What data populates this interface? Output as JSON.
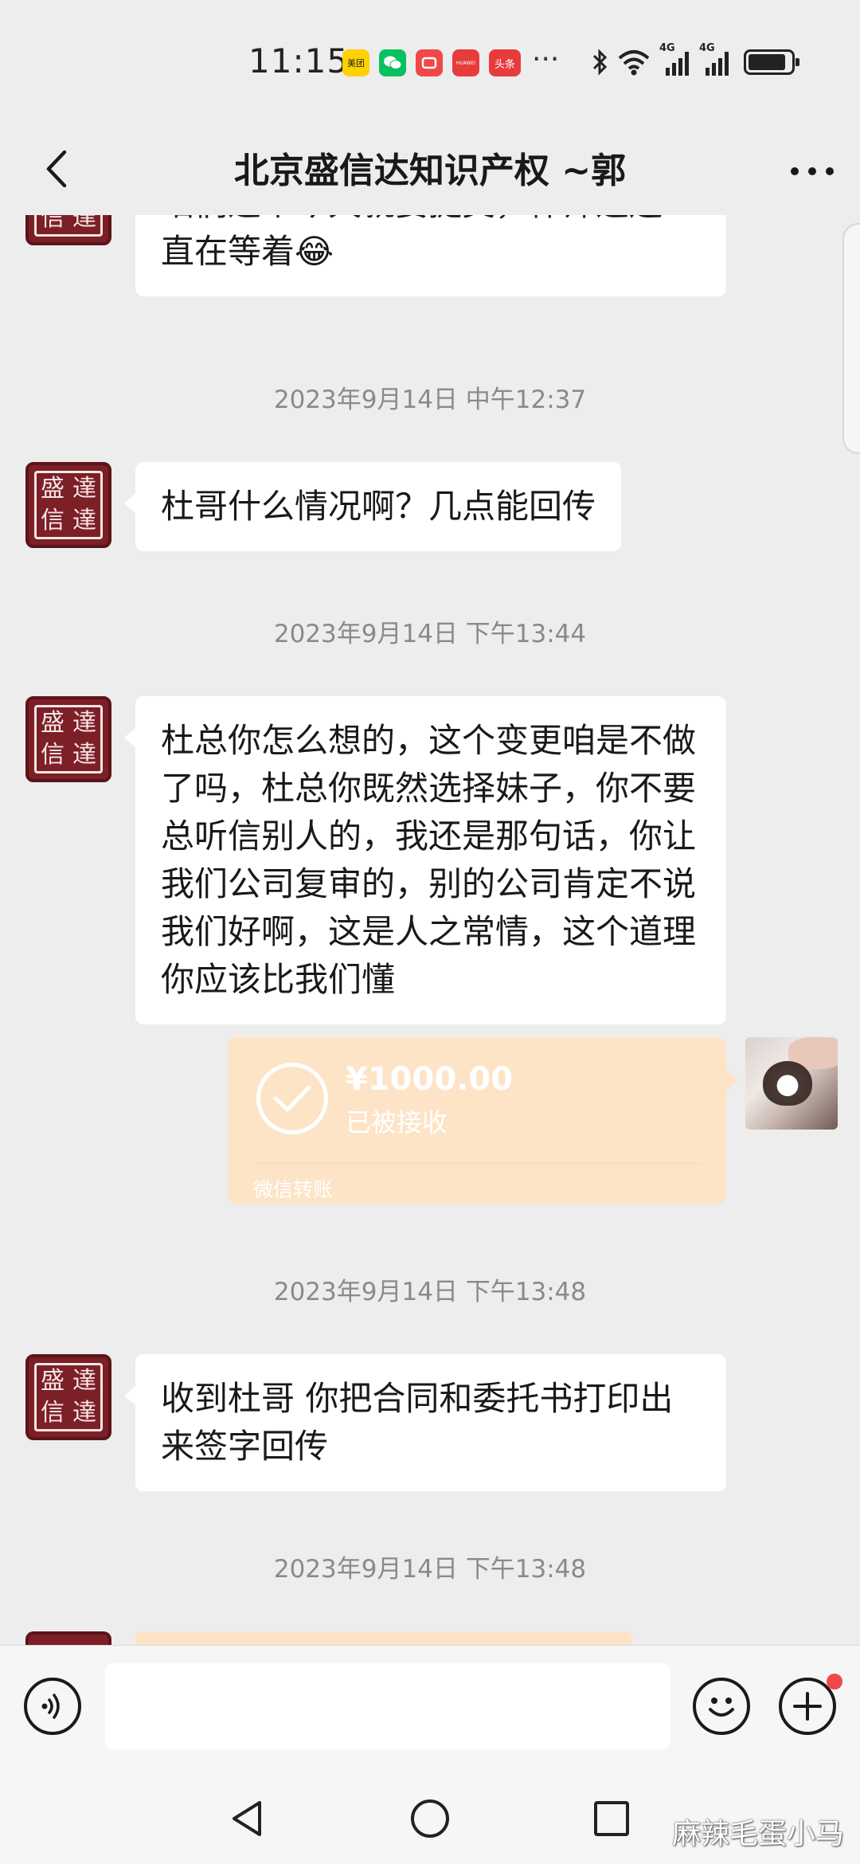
{
  "status_bar": {
    "time": "11:15",
    "app_badges": [
      {
        "text": "美团",
        "color": "#ffd100",
        "fg": "#222222"
      },
      {
        "text": "",
        "color": "#07c160",
        "fg": "#ffffff"
      },
      {
        "text": "",
        "color": "#f04848",
        "fg": "#ffffff"
      },
      {
        "text": "HUAWEI",
        "color": "#e83b3b",
        "fg": "#ffffff"
      },
      {
        "text": "头条",
        "color": "#e83b3b",
        "fg": "#ffffff"
      }
    ],
    "more": "···",
    "signal1_label": "4G",
    "signal2_label": "4G"
  },
  "header": {
    "title": "北京盛信达知识产权 ~郭"
  },
  "messages": [
    {
      "text": "咱们这个今天就要提交，律师这边一直在等着😂"
    },
    {
      "timestamp": "2023年9月14日 中午12:37"
    },
    {
      "text": "杜哥什么情况啊？几点能回传"
    },
    {
      "timestamp": "2023年9月14日 下午13:44"
    },
    {
      "text": "杜总你怎么想的，这个变更咱是不做了吗，杜总你既然选择妹子，你不要总听信别人的，我还是那句话，你让我们公司复审的，别的公司肯定不说我们好啊，这是人之常情，这个道理你应该比我们懂"
    },
    {
      "timestamp": "2023年9月14日 下午13:48"
    },
    {
      "text": "收到杜哥 你把合同和委托书打印出来签字回传"
    },
    {
      "timestamp": "2023年9月14日 下午13:48"
    }
  ],
  "transfer": {
    "amount": "¥1000.00",
    "status": "已被接收",
    "label": "微信转账",
    "color": "#fde4c7"
  },
  "avatar_chars": [
    "盛",
    "達",
    "信",
    "達"
  ],
  "input": {
    "placeholder": ""
  },
  "watermark": "麻辣毛蛋小马",
  "colors": {
    "background": "#ededed",
    "bubble": "#ffffff",
    "avatar": "#7d1f26",
    "badge_dot": "#f04848"
  }
}
